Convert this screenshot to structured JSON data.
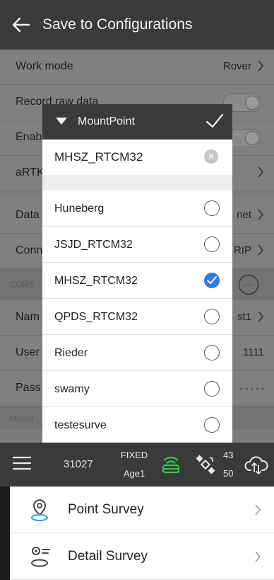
{
  "header": {
    "title": "Save to Configurations"
  },
  "settings": {
    "work_mode": {
      "label": "Work mode",
      "value": "Rover"
    },
    "record_raw": {
      "label": "Record raw data"
    },
    "enable_row": {
      "label": "Enab"
    },
    "artk_row": {
      "label": "aRTK"
    },
    "data_row": {
      "label": "Data",
      "value": "net"
    },
    "conn_row": {
      "label": "Conn",
      "value": "RIP"
    },
    "cors_section": {
      "label": "CORS"
    },
    "name_row": {
      "label": "Nam",
      "value": "st1"
    },
    "user_row": {
      "label": "User",
      "value": "1111"
    },
    "pass_row": {
      "label": "Pass",
      "value": "• • • • •"
    },
    "mount_section": {
      "label": "Mount"
    }
  },
  "dialog": {
    "title": "MountPoint",
    "input_value": "MHSZ_RTCM32",
    "items": [
      {
        "name": "Huneberg",
        "selected": false
      },
      {
        "name": "JSJD_RTCM32",
        "selected": false
      },
      {
        "name": "MHSZ_RTCM32",
        "selected": true
      },
      {
        "name": "QPDS_RTCM32",
        "selected": false
      },
      {
        "name": "Rieder",
        "selected": false
      },
      {
        "name": "swamy",
        "selected": false
      },
      {
        "name": "testesurve",
        "selected": false
      }
    ]
  },
  "status": {
    "number": "31027",
    "solution": "FIXED",
    "age": "Age1",
    "sats_used": "43",
    "sats_total": "50"
  },
  "bottom_menu": {
    "items": [
      {
        "label": "Point Survey"
      },
      {
        "label": "Detail Survey"
      }
    ]
  },
  "colors": {
    "header_bg": "#3a3a3a",
    "accent_blue": "#2e7be6",
    "rover_green": "#2ecc40"
  }
}
